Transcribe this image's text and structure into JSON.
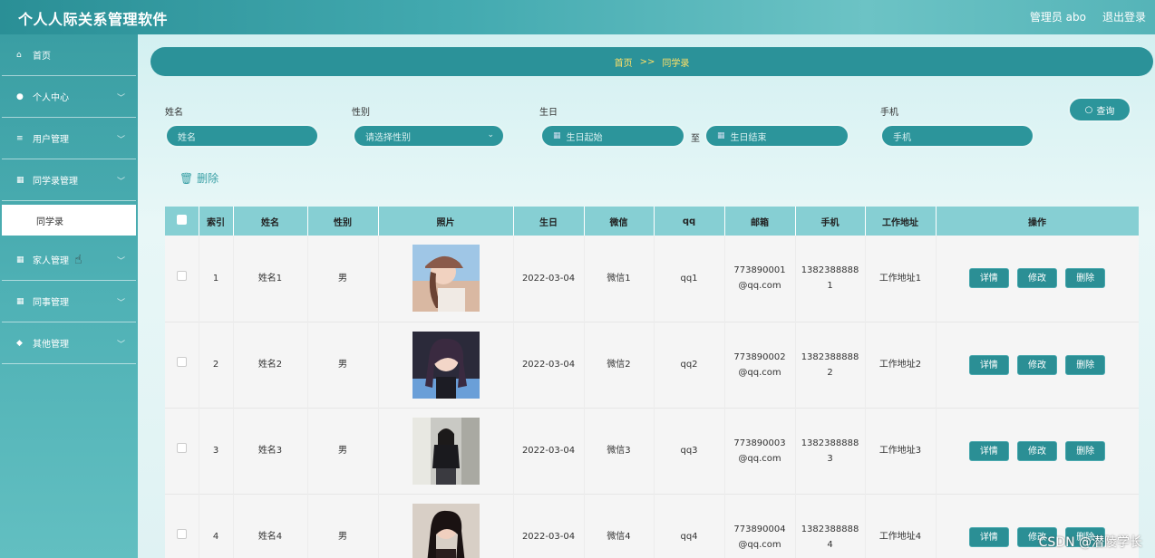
{
  "header": {
    "title": "个人人际关系管理软件",
    "user": "管理员 abo",
    "logout": "退出登录"
  },
  "sidebar": {
    "items": [
      {
        "label": "首页",
        "icon": "home-icon",
        "glyph": "⌂",
        "chevron": false
      },
      {
        "label": "个人中心",
        "icon": "person-icon",
        "glyph": "●",
        "chevron": true
      },
      {
        "label": "用户管理",
        "icon": "list-icon",
        "glyph": "≡",
        "chevron": true
      },
      {
        "label": "同学录管理",
        "icon": "grid-icon",
        "glyph": "▦",
        "chevron": true
      },
      {
        "label": "家人管理",
        "icon": "grid-icon",
        "glyph": "▦",
        "chevron": true
      },
      {
        "label": "同事管理",
        "icon": "grid-icon",
        "glyph": "▦",
        "chevron": true
      },
      {
        "label": "其他管理",
        "icon": "thumb-icon",
        "glyph": "◆",
        "chevron": true
      }
    ],
    "sub_active": "同学录"
  },
  "breadcrumb": {
    "home": "首页",
    "sep": ">>",
    "current": "同学录"
  },
  "search": {
    "name_label": "姓名",
    "name_placeholder": "姓名",
    "gender_label": "性别",
    "gender_placeholder": "请选择性别",
    "birthday_label": "生日",
    "birthday_start": "生日起始",
    "to": "至",
    "birthday_end": "生日结束",
    "phone_label": "手机",
    "phone_placeholder": "手机",
    "query": "查询"
  },
  "actions": {
    "delete": "删除"
  },
  "table": {
    "headers": [
      "",
      "索引",
      "姓名",
      "性别",
      "照片",
      "生日",
      "微信",
      "qq",
      "邮箱",
      "手机",
      "工作地址",
      "操作"
    ],
    "rows": [
      {
        "index": "1",
        "name": "姓名1",
        "gender": "男",
        "birthday": "2022-03-04",
        "wechat": "微信1",
        "qq": "qq1",
        "email1": "773890001",
        "email2": "@qq.com",
        "phone1": "1382388888",
        "phone2": "1",
        "address": "工作地址1"
      },
      {
        "index": "2",
        "name": "姓名2",
        "gender": "男",
        "birthday": "2022-03-04",
        "wechat": "微信2",
        "qq": "qq2",
        "email1": "773890002",
        "email2": "@qq.com",
        "phone1": "1382388888",
        "phone2": "2",
        "address": "工作地址2"
      },
      {
        "index": "3",
        "name": "姓名3",
        "gender": "男",
        "birthday": "2022-03-04",
        "wechat": "微信3",
        "qq": "qq3",
        "email1": "773890003",
        "email2": "@qq.com",
        "phone1": "1382388888",
        "phone2": "3",
        "address": "工作地址3"
      },
      {
        "index": "4",
        "name": "姓名4",
        "gender": "男",
        "birthday": "2022-03-04",
        "wechat": "微信4",
        "qq": "qq4",
        "email1": "773890004",
        "email2": "@qq.com",
        "phone1": "1382388888",
        "phone2": "4",
        "address": "工作地址4"
      }
    ],
    "ops": {
      "detail": "详情",
      "edit": "修改",
      "delete": "删除"
    }
  },
  "watermark": "CSDN @潜陵学长",
  "colors": {
    "primary": "#2b9299",
    "breadcrumb_text": "#ffe066",
    "table_header": "#86cfd3"
  }
}
